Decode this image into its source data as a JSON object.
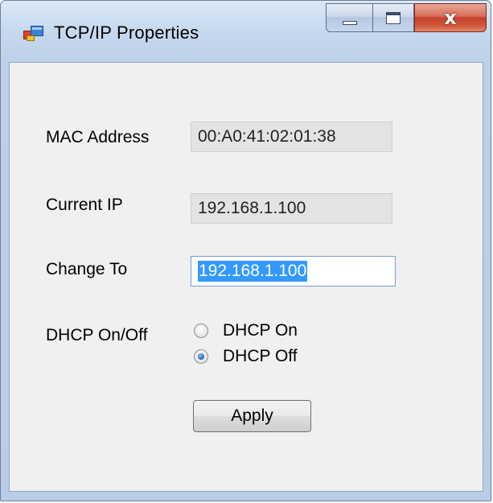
{
  "window": {
    "title": "TCP/IP Properties",
    "close_glyph": "x"
  },
  "form": {
    "mac_label": "MAC Address",
    "mac_value": "00:A0:41:02:01:38",
    "current_ip_label": "Current IP",
    "current_ip_value": "192.168.1.100",
    "change_to_label": "Change To",
    "change_to_value": "192.168.1.100",
    "dhcp_label": "DHCP On/Off",
    "dhcp_options": [
      {
        "label": "DHCP On",
        "checked": false
      },
      {
        "label": "DHCP Off",
        "checked": true
      }
    ],
    "apply_label": "Apply"
  },
  "colors": {
    "selection": "#3399ff",
    "close_button": "#c5412a",
    "client_background": "#f0f0f0"
  },
  "icons": {
    "app": "window-app-icon",
    "minimize": "minimize-icon",
    "maximize": "maximize-icon",
    "close": "close-icon"
  }
}
